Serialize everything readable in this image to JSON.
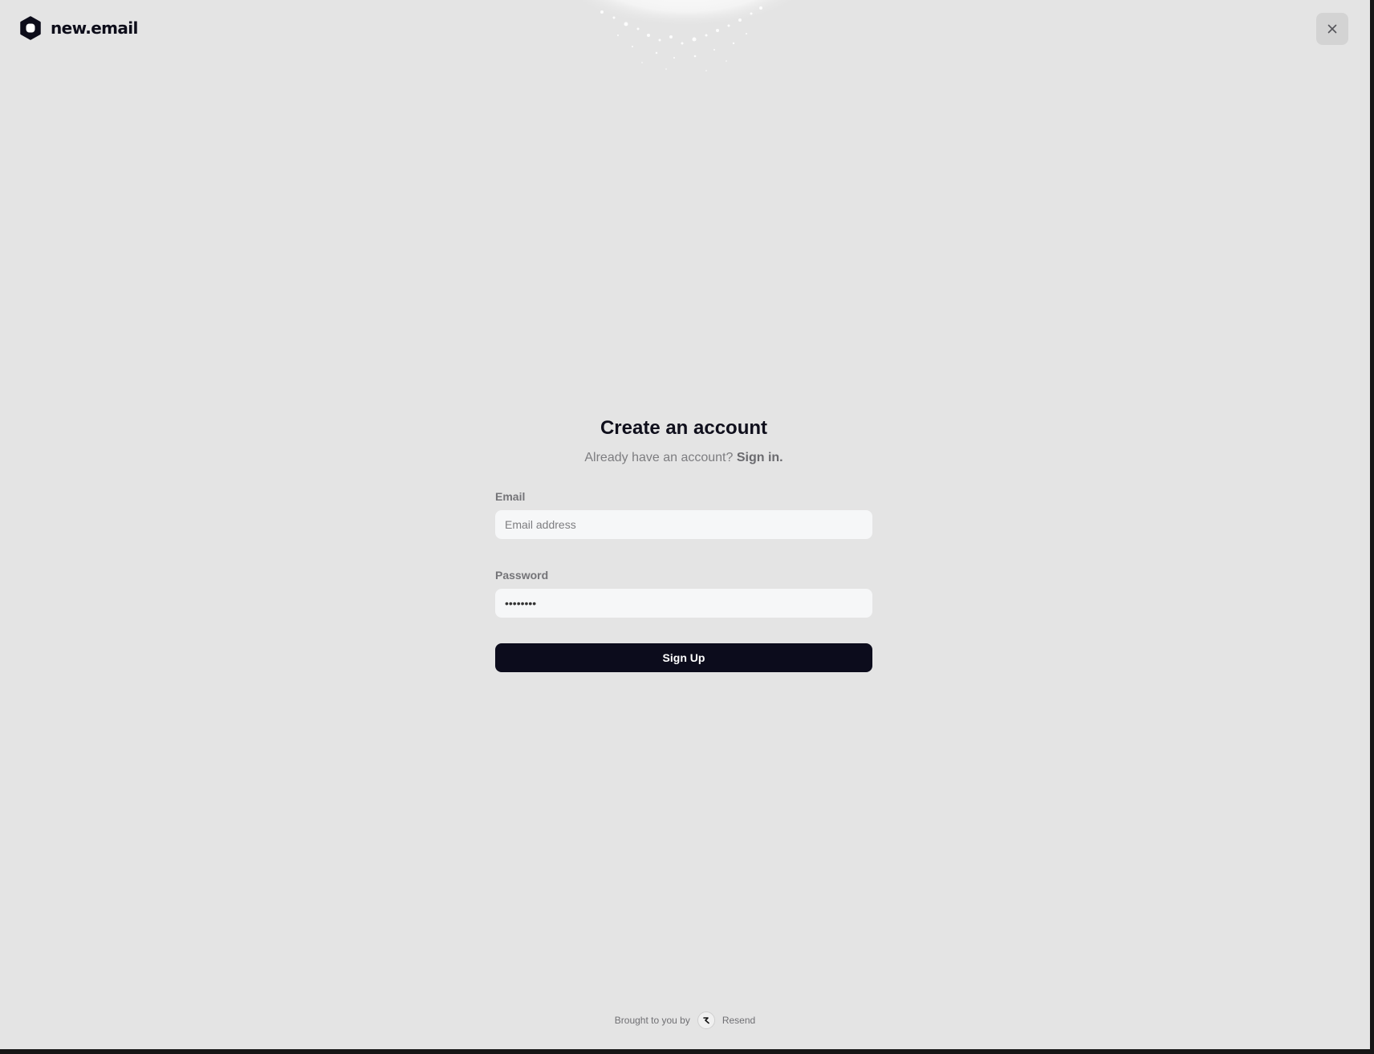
{
  "header": {
    "brand": "new.email",
    "logo_icon": "new-email-logo-icon",
    "close_icon": "close-icon"
  },
  "form": {
    "title": "Create an account",
    "subtitle_prefix": "Already have an account?",
    "signin_link": "Sign in.",
    "email_label": "Email",
    "email_placeholder": "Email address",
    "email_value": "",
    "password_label": "Password",
    "password_value": "••••••••",
    "submit_label": "Sign Up"
  },
  "footer": {
    "prefix": "Brought to you by",
    "brand": "Resend",
    "brand_icon": "resend-logo-icon"
  },
  "colors": {
    "background": "#e4e4e4",
    "primary_button": "#0c0c1c",
    "input_background": "#f6f7f8",
    "text_dark": "#0f0f1c",
    "text_muted": "#7d7d80"
  }
}
